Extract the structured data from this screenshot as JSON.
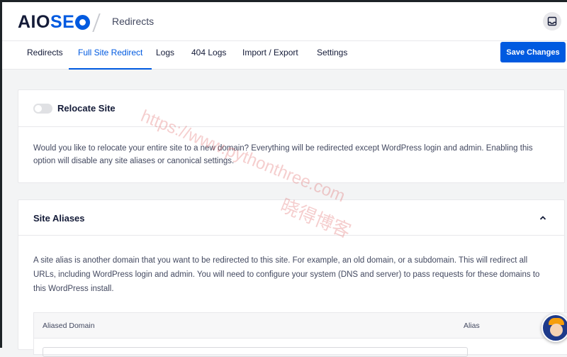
{
  "header": {
    "logo_text": "AIOSEO",
    "page_heading": "Redirects",
    "help_icon": "inbox-icon"
  },
  "nav": {
    "tabs": [
      {
        "label": "Redirects",
        "active": false
      },
      {
        "label": "Full Site Redirect",
        "active": true
      },
      {
        "label": "Logs",
        "active": false
      },
      {
        "label": "404 Logs",
        "active": false
      },
      {
        "label": "Import / Export",
        "active": false
      },
      {
        "label": "Settings",
        "active": false
      }
    ],
    "save_label": "Save Changes"
  },
  "relocate": {
    "title": "Relocate Site",
    "enabled": false,
    "description": "Would you like to relocate your entire site to a new domain? Everything will be redirected except WordPress login and admin. Enabling this option will disable any site aliases or canonical settings."
  },
  "aliases": {
    "title": "Site Aliases",
    "expanded": true,
    "description": "A site alias is another domain that you want to be redirected to this site. For example, an old domain, or a subdomain. This will redirect all URLs, including WordPress login and admin. You will need to configure your system (DNS and server) to pass requests for these domains to this WordPress install.",
    "table_headers": [
      "Aliased Domain",
      "Alias"
    ]
  },
  "watermark": {
    "url": "https://www.pythonthree.com",
    "name": "晓得博客"
  },
  "colors": {
    "accent": "#005ae0",
    "text": "#141b38",
    "muted_text": "#434960",
    "background": "#f3f4f5"
  }
}
